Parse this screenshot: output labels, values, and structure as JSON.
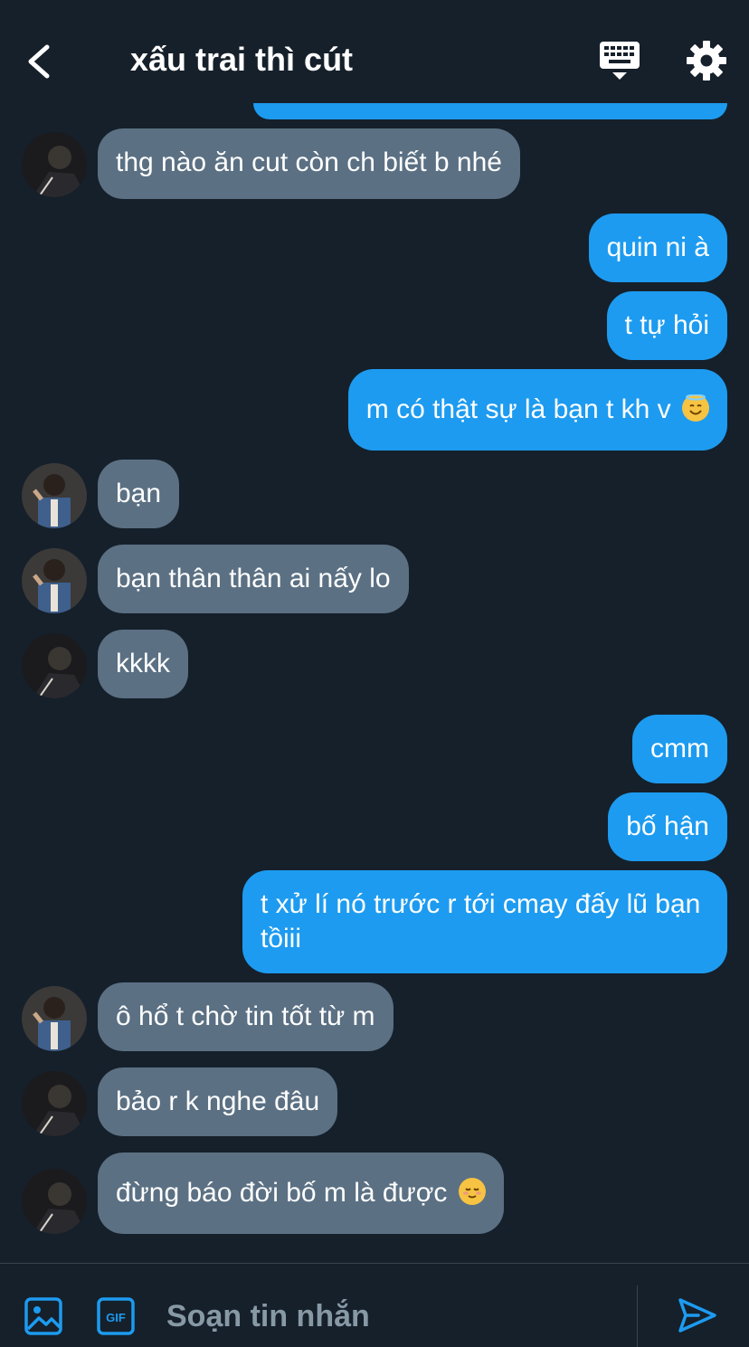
{
  "header": {
    "title": "xấu trai thì cút",
    "back_icon": "chevron-left-icon",
    "keyboard_icon": "keyboard-icon",
    "settings_icon": "gear-icon"
  },
  "messages": [
    {
      "side": "in",
      "text": "thg nào ăn cut còn ch biết b nhé"
    },
    {
      "side": "out",
      "text": "quin ni à"
    },
    {
      "side": "out",
      "text": "t tự hỏi"
    },
    {
      "side": "out",
      "text": "m có thật sự là bạn t kh v",
      "emoji": "😇"
    },
    {
      "side": "in",
      "text": "bạn"
    },
    {
      "side": "in",
      "text": "bạn thân thân ai nấy lo"
    },
    {
      "side": "in",
      "text": "kkkk"
    },
    {
      "side": "out",
      "text": "cmm"
    },
    {
      "side": "out",
      "text": "bố hận"
    },
    {
      "side": "out",
      "text": "t xử lí nó trước r tới cmay đấy lũ bạn tồiii"
    },
    {
      "side": "in",
      "text": "ô hổ t chờ tin tốt từ m"
    },
    {
      "side": "in",
      "text": "bảo r k nghe đâu"
    },
    {
      "side": "in",
      "text": "đừng báo đời bố m là được",
      "emoji": "😌"
    }
  ],
  "composer": {
    "placeholder": "Soạn tin nhắn",
    "image_icon": "image-icon",
    "gif_icon": "gif-icon",
    "gif_label": "GIF",
    "send_icon": "send-icon"
  },
  "colors": {
    "background": "#15202b",
    "incoming_bubble": "#5b7083",
    "outgoing_bubble": "#1d9bf0",
    "accent": "#1d9bf0",
    "placeholder": "#8899a6"
  }
}
